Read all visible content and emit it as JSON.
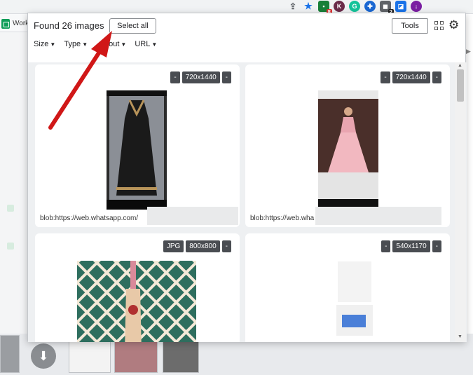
{
  "browser": {
    "bookmark_label": "Work",
    "extensions": [
      {
        "name": "share-icon",
        "color": "#5f6368",
        "glyph": "⇪",
        "badge": ""
      },
      {
        "name": "star-icon",
        "color": "#1a73e8",
        "glyph": "★",
        "badge": ""
      },
      {
        "name": "green-extension-icon",
        "color": "#188038",
        "glyph": "⬛",
        "badge": "8"
      },
      {
        "name": "k-extension-icon",
        "color": "#6b2c4a",
        "glyph": "K",
        "badge": ""
      },
      {
        "name": "grammarly-icon",
        "color": "#15c39a",
        "glyph": "G",
        "badge": ""
      },
      {
        "name": "blue-extension-icon",
        "color": "#1967d2",
        "glyph": "✚",
        "badge": ""
      },
      {
        "name": "dark-extension-icon",
        "color": "#5f6368",
        "glyph": "◼",
        "badge": "2"
      },
      {
        "name": "blue-square-icon",
        "color": "#1a73e8",
        "glyph": "◪",
        "badge": ""
      },
      {
        "name": "download-extension-icon",
        "color": "#7b1fa2",
        "glyph": "↓",
        "badge": ""
      }
    ]
  },
  "popup": {
    "title": "Found 26 images",
    "select_all_label": "Select all",
    "tools_label": "Tools",
    "filters": [
      {
        "label": "Size"
      },
      {
        "label": "Type"
      },
      {
        "label": "out"
      },
      {
        "label": "URL"
      }
    ],
    "cards": [
      {
        "type": "-",
        "dimensions": "720x1440",
        "extra": "-",
        "url": "blob:https://web.whatsapp.com/"
      },
      {
        "type": "-",
        "dimensions": "720x1440",
        "extra": "-",
        "url": "blob:https://web.wha"
      },
      {
        "type": "JPG",
        "dimensions": "800x800",
        "extra": "-",
        "url": ""
      },
      {
        "type": "-",
        "dimensions": "540x1170",
        "extra": "-",
        "url": ""
      }
    ]
  },
  "colors": {
    "arrow": "#d01717",
    "tag_bg": "#4a4d52",
    "list_bg": "#eef0f2"
  }
}
